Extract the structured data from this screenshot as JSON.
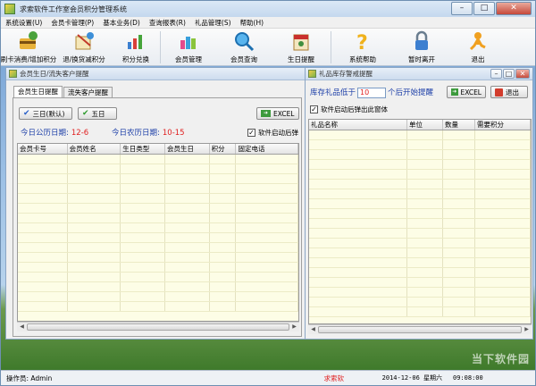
{
  "window": {
    "title": "求索软件工作室会员积分管理系统",
    "minimize": "–",
    "maximize": "□",
    "close": "✕"
  },
  "menu": [
    "系统设置(U)",
    "会员卡管理(P)",
    "基本业务(D)",
    "查询报表(R)",
    "礼品管理(S)",
    "帮助(H)"
  ],
  "toolbar": [
    {
      "label": "刷卡消费/增加积分",
      "icon": "card-swipe-icon"
    },
    {
      "label": "退/换货减积分",
      "icon": "return-goods-icon"
    },
    {
      "label": "积分兑换",
      "icon": "points-exchange-icon"
    },
    {
      "label": "会员管理",
      "icon": "member-manage-icon"
    },
    {
      "label": "会员查询",
      "icon": "member-search-icon"
    },
    {
      "label": "生日提醒",
      "icon": "birthday-reminder-icon"
    },
    {
      "label": "系统帮助",
      "icon": "help-icon"
    },
    {
      "label": "暂时离开",
      "icon": "lock-icon"
    },
    {
      "label": "退出",
      "icon": "exit-icon"
    }
  ],
  "birthday_window": {
    "title": "会员生日/流失客户提醒",
    "tabs": [
      "会员生日提醒",
      "流失客户提醒"
    ],
    "btn_three_days": "三日(默认)",
    "btn_five_days": "五日",
    "btn_excel": "EXCEL",
    "solar_label": "今日公历日期:",
    "solar_value": "12-6",
    "lunar_label": "今日农历日期:",
    "lunar_value": "10-15",
    "autostart_label": "软件启动后弹",
    "columns": [
      "会员卡号",
      "会员姓名",
      "生日类型",
      "会员生日",
      "积分",
      "固定电话"
    ]
  },
  "gift_window": {
    "title": "礼品库存警戒提醒",
    "low_prefix": "库存礼品低于",
    "low_value": "10",
    "low_suffix": "个后开始提醒",
    "btn_excel": "EXCEL",
    "btn_exit": "退出",
    "autostart_label": "软件启动后弹出此窗体",
    "columns": [
      "礼品名称",
      "单位",
      "数量",
      "需要积分"
    ]
  },
  "status": {
    "operator": "操作员: Admin",
    "middle": "求索软",
    "date": "2014-12-06 星期六",
    "time": "09:08:00"
  },
  "watermark": "当下软件园"
}
